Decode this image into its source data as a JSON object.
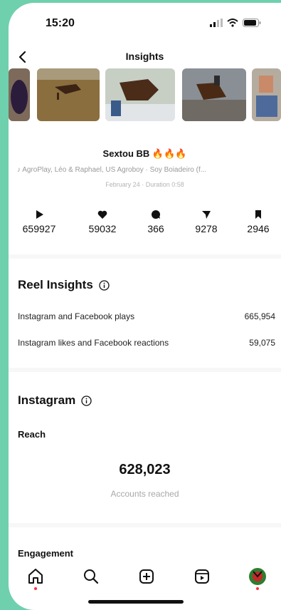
{
  "status": {
    "time": "15:20"
  },
  "nav": {
    "title": "Insights"
  },
  "reel": {
    "title": "Sextou BB 🔥🔥🔥",
    "audio": "AgroPlay, Léo & Raphael, US Agroboy · Soy Boiadeiro (f...",
    "meta": "February 24 · Duration 0:58"
  },
  "stats": [
    {
      "icon": "play-icon",
      "value": "659927"
    },
    {
      "icon": "heart-icon",
      "value": "59032"
    },
    {
      "icon": "comment-icon",
      "value": "366"
    },
    {
      "icon": "send-icon",
      "value": "9278"
    },
    {
      "icon": "bookmark-icon",
      "value": "2946"
    }
  ],
  "reel_insights": {
    "heading": "Reel Insights",
    "rows": [
      {
        "label": "Instagram and Facebook plays",
        "value": "665,954"
      },
      {
        "label": "Instagram likes and Facebook reactions",
        "value": "59,075"
      }
    ]
  },
  "instagram": {
    "heading": "Instagram",
    "reach_label": "Reach",
    "reach_value": "628,023",
    "reach_caption": "Accounts reached",
    "engagement_label": "Engagement"
  },
  "tabbar": [
    "home-icon",
    "search-icon",
    "create-icon",
    "reels-icon",
    "profile-avatar"
  ]
}
